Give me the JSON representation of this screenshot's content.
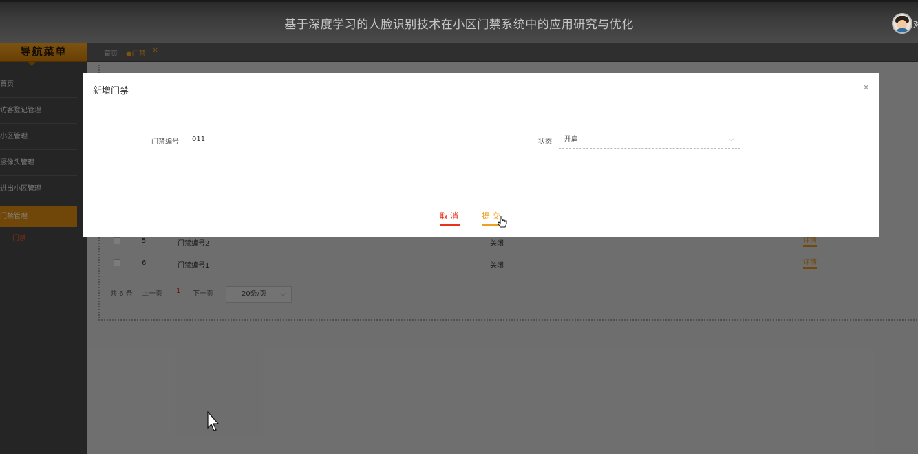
{
  "header": {
    "title": "基于深度学习的人脸识别技术在小区门禁系统中的应用研究与优化",
    "user_label": "对"
  },
  "sidebar": {
    "title": "导航菜单",
    "items": [
      {
        "label": "首页"
      },
      {
        "label": "访客登记管理"
      },
      {
        "label": "小区管理"
      },
      {
        "label": "摄像头管理"
      },
      {
        "label": "进出小区管理"
      },
      {
        "label": "门禁管理"
      }
    ],
    "sub_item": "门禁"
  },
  "tabs": {
    "home": "首页",
    "current": "●门禁",
    "close": "×"
  },
  "table": {
    "rows": [
      {
        "index": "5",
        "code": "门禁编号2",
        "status": "关闭",
        "action": "详情"
      },
      {
        "index": "6",
        "code": "门禁编号1",
        "status": "关闭",
        "action": "详情"
      }
    ]
  },
  "pager": {
    "total": "共 6 条",
    "prev": "上一页",
    "current": "1",
    "next": "下一页",
    "page_size": "20条/页",
    "arrow": "⌵"
  },
  "modal": {
    "title": "新增门禁",
    "close": "×",
    "code_label": "门禁编号",
    "code_value": "011",
    "status_label": "状态",
    "status_value": "开启",
    "chevron": "⌵",
    "cancel": "取消",
    "submit": "提交"
  },
  "colors": {
    "accent": "#f0a020",
    "danger": "#e8321e",
    "sidebar_bg": "#474747"
  }
}
